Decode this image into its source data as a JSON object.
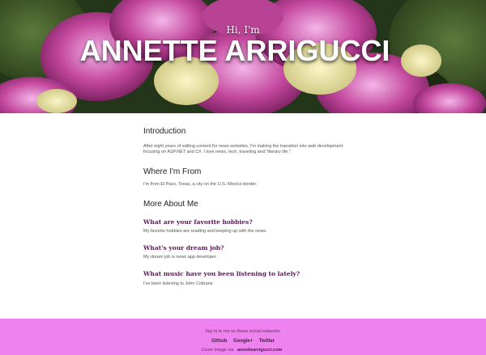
{
  "hero": {
    "greeting": "Hi, I'm",
    "name": "ANNETTE ARRIGUCCI"
  },
  "intro": {
    "heading": "Introduction",
    "text": "After eight years of editing content for news websites, I'm making the transition into web development focusing on ASP.NET and C#. I love news, tech, traveling and \"literary life.\""
  },
  "from": {
    "heading": "Where I'm From",
    "text": "I'm from El Paso, Texas, a city on the U.S.-Mexico border."
  },
  "more": {
    "heading": "More About Me",
    "items": [
      {
        "q": "What are your favorite hobbies?",
        "a": "My favorite hobbies are reading and keeping up with the news."
      },
      {
        "q": "What's your dream job?",
        "a": "My dream job is news app developer."
      },
      {
        "q": "What music have you been listening to lately?",
        "a": "I've been listening to John Coltrane."
      }
    ]
  },
  "footer": {
    "prompt": "Say hi to me on these social networks:",
    "links": [
      "Github",
      "Google+",
      "Twitter"
    ],
    "cover_prefix": "Cover image via",
    "cover_link": "annettearrigucci.com"
  },
  "colors": {
    "footer_bg": "#ee82ee",
    "question": "#5a1a5a"
  }
}
